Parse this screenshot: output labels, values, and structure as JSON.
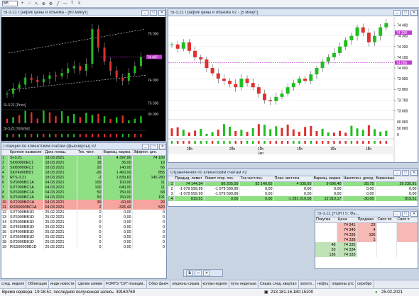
{
  "toolbar": {
    "interval": "M5"
  },
  "w1": {
    "title": "Si-3.21 График цены и объёма - [60 минут]",
    "price_label": "Si-3.21 [Price]",
    "vol_label": "Si-3.21 [Volume]",
    "ticks": [
      "75 000",
      "74 500",
      "74 000",
      "73 500"
    ],
    "vol_ticks": [
      "00 000",
      "00 000"
    ],
    "flag1": "74 497",
    "flag2": "74 000"
  },
  "w2": {
    "title": "Si-3.21 График цены и объёма #2 - [5 минут]",
    "ticks": [
      "74 400",
      "74 300",
      "74 200",
      "74 100",
      "74 000",
      "73 900",
      "73 800",
      "73 700",
      "73 600"
    ],
    "flag1": "74 497",
    "flag2": "74 330",
    "flag3": "74 050",
    "vol_ticks": [
      "00 000",
      "50 000",
      "0"
    ],
    "dates": [
      "28h",
      "29h",
      "10h",
      "15h",
      "16h",
      "18h"
    ],
    "date_sub": [
      "",
      "",
      "Jan",
      "",
      "",
      ""
    ]
  },
  "w3": {
    "title": "Позиции по клиентским счетам (фьючерсы) #2",
    "cols": [
      "Краткое название",
      "Дата погаш.",
      "Тек. чист.",
      "Вариац. маржа",
      "Эффект. цен."
    ],
    "rows": [
      [
        "Si-3.21",
        "18.03.2021",
        "11",
        "4 397,00",
        "74 189",
        "g"
      ],
      [
        "Si090000EC1",
        "18.03.2021",
        "18",
        "36,00",
        "19",
        "g"
      ],
      [
        "Si080000EC1",
        "18.03.2021",
        "20",
        "140,00",
        "66",
        "g"
      ],
      [
        "Si074000BD1",
        "18.03.2021",
        "-26",
        "1 460,00",
        "855",
        "g"
      ],
      [
        "RTS-3.21",
        "18.03.2021",
        "-2",
        "1 839,82",
        "145 280",
        "g"
      ],
      [
        "Si79000BC1A",
        "04.03.2021",
        "100",
        "100,00",
        "11",
        "g"
      ],
      [
        "Si77000BC1A",
        "04.03.2021",
        "100",
        "640,00",
        "11",
        "g"
      ],
      [
        "Si76000BC1A",
        "04.03.2021",
        "50",
        "750,00",
        "68",
        "g"
      ],
      [
        "Si75000BC1A",
        "04.03.2021",
        "50",
        "760,00",
        "191",
        "g"
      ],
      [
        "Si72000BO1A",
        "04.03.2021",
        "30",
        "-60,00",
        "20",
        "r"
      ],
      [
        "RI150000BC1A",
        "04.03.2021",
        "2",
        "-326,42",
        "520",
        "r"
      ],
      [
        "Si77000BB1D",
        "25.02.2021",
        "0",
        "0,00",
        "0",
        "w"
      ],
      [
        "Si76000BB1D",
        "25.02.2021",
        "0",
        "0,00",
        "0",
        "w"
      ],
      [
        "Si75000BB1D",
        "25.02.2021",
        "0",
        "0,00",
        "0",
        "w"
      ],
      [
        "Si74500BB1D",
        "25.02.2021",
        "0",
        "0,00",
        "0",
        "w"
      ],
      [
        "Si74000BB1D",
        "25.02.2021",
        "0",
        "0,00",
        "0",
        "w"
      ],
      [
        "Si73500BB1D",
        "25.02.2021",
        "0",
        "0,00",
        "0",
        "w"
      ],
      [
        "Si73000BB1D",
        "25.02.2021",
        "0",
        "0,00",
        "0",
        "w"
      ],
      [
        "RI150000BB1D",
        "25.02.2021",
        "0",
        "0,00",
        "0",
        "w"
      ]
    ],
    "row_nums": [
      "1",
      "2",
      "3",
      "4",
      "5",
      "6",
      "7",
      "8",
      "9",
      "10",
      "11",
      "12",
      "13",
      "14",
      "15",
      "16",
      "17",
      "18",
      "19"
    ]
  },
  "w4": {
    "title": "Ограничения по клиентским счетам #2",
    "cols": [
      "Предыд. лимит",
      "Лимит откр. поз.",
      "Тек.чист.поз.",
      "План чист.поз.",
      "Вариац. маржа",
      "Накоплен. доход",
      "Биржевые"
    ],
    "rows": [
      [
        "1",
        "74 144,34",
        "86 205,00",
        "82 140,65",
        "4 035,60",
        "9 696,40",
        "-28,75",
        "26 235,91",
        "g"
      ],
      [
        "2",
        "-1 079 599,99",
        "-1 079 599,99",
        "0,00",
        "0,00",
        "0,00",
        "0,00",
        "0,00",
        "w"
      ],
      [
        "3",
        "-1 079 599,99",
        "-1 079 599,99",
        "0,00",
        "0,00",
        "0,00",
        "0,00",
        "0,00",
        "w"
      ],
      [
        "4",
        "819,51",
        "0,00",
        "0,00",
        "-1 281 219,08",
        "12 910,17",
        "-30,00",
        "819,51",
        "g"
      ]
    ]
  },
  "w5": {
    "title": "Si-3.21 [FORTS: Фь...",
    "cols": [
      "Покупка",
      "Цена",
      "Продажа",
      "Своя по",
      "Своя п"
    ],
    "rows": [
      [
        "",
        "74 341",
        "23",
        "",
        ""
      ],
      [
        "",
        "74 340",
        "4",
        "",
        ""
      ],
      [
        "",
        "74 339",
        "106",
        "",
        ""
      ],
      [
        "",
        "74 338",
        "1",
        "",
        ""
      ],
      [
        "48",
        "74 335",
        "",
        "",
        ""
      ],
      [
        "20",
        "74 334",
        "",
        "",
        ""
      ],
      [
        "136",
        "74 333",
        "",
        "",
        ""
      ]
    ]
  },
  "taskbar": [
    "след. неделя",
    "Облигации",
    "индж новости",
    "сделки заявки",
    "FORTS \"СИ\" позиции..",
    "Сбер фьюч",
    "опционы сишка",
    "коллы неделя",
    "путы неделька",
    "Сишка след. квартал",
    "золото..",
    "нефть",
    "опционы ртс",
    "серебро"
  ],
  "status": {
    "text": "Время сервера: 19:16:51; последняя полученная запись: 39160769",
    "ip": "213.181.16.180:15100",
    "date": "25.02.2021"
  },
  "chart_data": [
    {
      "type": "line",
      "title": "Si-3.21 [60 минут]",
      "series": [
        {
          "name": "Si-3.21",
          "values": [
            73700,
            73820,
            73900,
            74050,
            74000,
            73950,
            74020,
            74100,
            74080,
            74150,
            74250,
            74300,
            74200,
            74350,
            75100,
            74700,
            74400,
            74200,
            74050,
            73980,
            74150,
            74300,
            74500
          ]
        }
      ],
      "ylim": [
        73400,
        75300
      ]
    },
    {
      "type": "line",
      "title": "Si-3.21 [5 минут]",
      "series": [
        {
          "name": "Si-3.21",
          "values": [
            74220,
            74180,
            74240,
            74160,
            74100,
            74080,
            74000,
            73950,
            73900,
            73880,
            73850,
            73820,
            73900,
            73860,
            73820,
            73760,
            73700,
            73690,
            73730,
            73760,
            73820,
            73860,
            73900,
            73880,
            73940,
            74000,
            74060,
            74100,
            74140,
            74200,
            74260,
            74300,
            74380,
            74330,
            74240,
            74300,
            74380,
            74420
          ]
        }
      ],
      "ylim": [
        73550,
        74450
      ]
    }
  ]
}
